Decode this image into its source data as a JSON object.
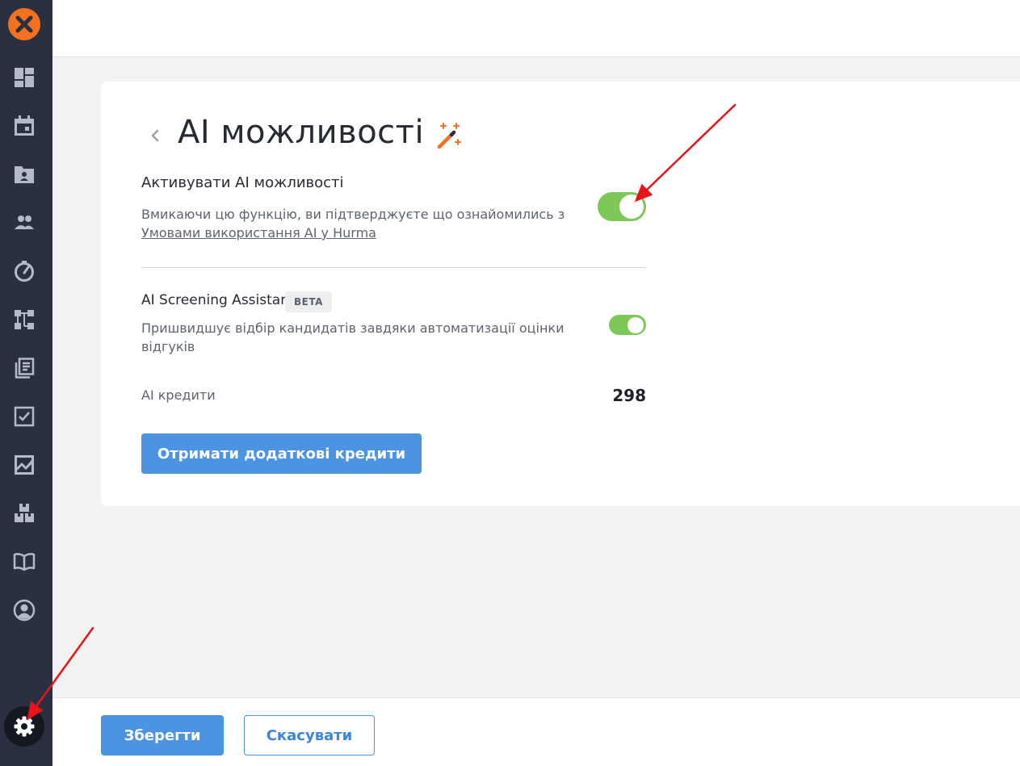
{
  "sidebar": {
    "logo_icon": "hurma-logo-icon",
    "items": [
      {
        "icon": "dashboard-icon"
      },
      {
        "icon": "calendar-icon"
      },
      {
        "icon": "employee-folder-icon"
      },
      {
        "icon": "people-icon"
      },
      {
        "icon": "speedometer-icon"
      },
      {
        "icon": "org-structure-icon"
      },
      {
        "icon": "documents-icon"
      },
      {
        "icon": "checklist-icon"
      },
      {
        "icon": "analytics-chart-icon"
      },
      {
        "icon": "boxes-icon"
      },
      {
        "icon": "book-icon"
      },
      {
        "icon": "profile-icon"
      }
    ],
    "settings_icon": "gear-icon"
  },
  "page": {
    "title": "AI можливості",
    "title_icon": "magic-wand-icon"
  },
  "ai_features": {
    "title": "Активувати AI можливості",
    "description": "Вмикаючи цю функцію, ви підтверджуєте що ознайомились з",
    "terms_link": "Умовами використання AI у Hurma",
    "enabled": true
  },
  "screening": {
    "title": "AI Screening Assistant",
    "badge": "BETA",
    "description": "Пришвидшує відбір кандидатів завдяки автоматизації оцінки відгуків",
    "enabled": true
  },
  "credits": {
    "label": "AI кредити",
    "value": "298",
    "button_label": "Отримати додаткові кредити"
  },
  "footer": {
    "save_label": "Зберегти",
    "cancel_label": "Скасувати"
  },
  "colors": {
    "accent": "#4c93e2",
    "toggle_on": "#7ec85a",
    "sidebar": "#2b3040",
    "logo": "#f4711f",
    "annotation_arrow": "#e8141a"
  }
}
